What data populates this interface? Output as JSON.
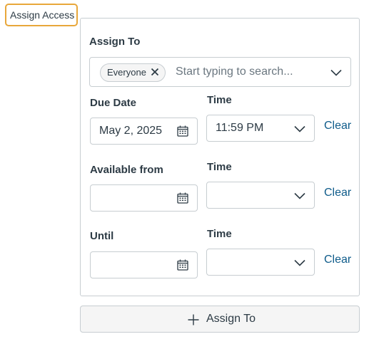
{
  "header": {
    "title": "Assign Access"
  },
  "assign_to": {
    "label": "Assign To",
    "tags": [
      "Everyone"
    ],
    "placeholder": "Start typing to search..."
  },
  "due": {
    "date_label": "Due Date",
    "date_value": "May 2, 2025",
    "time_label": "Time",
    "time_value": "11:59 PM",
    "clear": "Clear"
  },
  "available_from": {
    "date_label": "Available from",
    "date_value": "",
    "time_label": "Time",
    "time_value": "",
    "clear": "Clear"
  },
  "until": {
    "date_label": "Until",
    "date_value": "",
    "time_label": "Time",
    "time_value": "",
    "clear": "Clear"
  },
  "footer": {
    "assign_button": "Assign To"
  },
  "icons": [
    "close-icon",
    "chevron-down-icon",
    "calendar-icon",
    "plus-icon"
  ],
  "colors": {
    "focus_outline": "#e8a73a",
    "link": "#0e5b8a",
    "border": "#c7cdd1"
  }
}
